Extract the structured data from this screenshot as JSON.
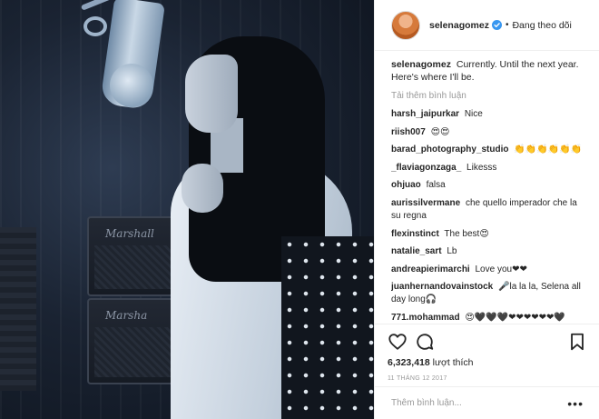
{
  "photo": {
    "amp_label_top": "Marshall",
    "amp_label_bottom": "Marsha"
  },
  "header": {
    "username": "selenagomez",
    "verified_icon": "verified-badge-icon",
    "separator": "•",
    "follow_status": "Đang theo dõi"
  },
  "caption": {
    "username": "selenagomez",
    "text": "Currently. Until the next year. Here's where I'll be."
  },
  "load_more_label": "Tải thêm bình luận",
  "comments": [
    {
      "user": "harsh_jaipurkar",
      "text": "Nice"
    },
    {
      "user": "riish007",
      "text": "😍😍"
    },
    {
      "user": "barad_photography_studio",
      "text": "👏👏👏👏👏👏"
    },
    {
      "user": "_flaviagonzaga_",
      "text": "Likesss"
    },
    {
      "user": "ohjuao",
      "text": "falsa"
    },
    {
      "user": "aurissilvermane",
      "text": "che quello imperador che la su regna"
    },
    {
      "user": "flexinstinct",
      "text": "The best😍"
    },
    {
      "user": "natalie_sart",
      "text": "Lb"
    },
    {
      "user": "andreapierimarchi",
      "text": "Love you❤❤"
    },
    {
      "user": "juanhernandovainstock",
      "text": "🎤la la la, Selena all day long🎧"
    },
    {
      "user": "771.mohammad",
      "text": "😍🖤🖤🖤❤❤❤❤❤❤🖤"
    }
  ],
  "actions": {
    "like_icon": "heart-icon",
    "comment_icon": "comment-icon",
    "save_icon": "bookmark-icon",
    "likes_count": "6,323,418",
    "likes_label": "lượt thích",
    "date": "11 THÁNG 12 2017"
  },
  "add_comment": {
    "placeholder": "Thêm bình luận...",
    "more_label": "•••"
  }
}
